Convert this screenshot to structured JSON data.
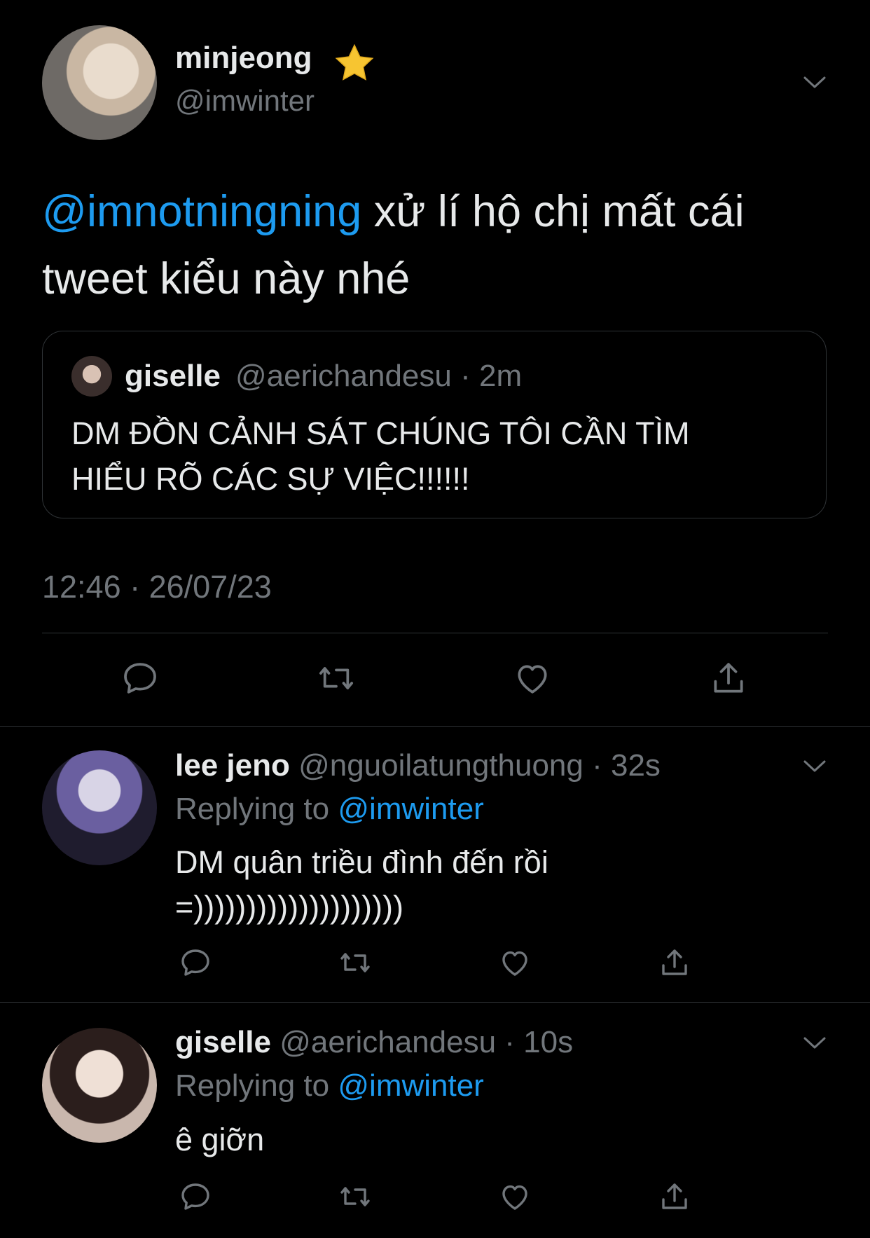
{
  "main_tweet": {
    "author_name": "minjeong",
    "author_handle": "@imwinter",
    "mention": "@imnotningning",
    "text": " xử lí hộ chị mất cái tweet kiểu này nhé",
    "timestamp": "12:46 · 26/07/23",
    "quoted": {
      "author_name": "giselle",
      "author_handle": "@aerichandesu",
      "time": "2m",
      "text": "DM ĐỒN CẢNH SÁT CHÚNG TÔI CẦN TÌM HIỂU RÕ CÁC SỰ VIỆC!!!!!!"
    }
  },
  "replies": [
    {
      "author_name": "lee jeno",
      "author_handle": "@nguoilatungthuong",
      "time": "32s",
      "replying_label": "Replying to",
      "replying_to": "@imwinter",
      "text": "DM quân triều đình đến rồi =))))))))))))))))))))"
    },
    {
      "author_name": "giselle",
      "author_handle": "@aerichandesu",
      "time": "10s",
      "replying_label": "Replying to",
      "replying_to": "@imwinter",
      "text": "ê giỡn"
    }
  ],
  "colors": {
    "background": "#000000",
    "text": "#e7e9ea",
    "muted": "#71767b",
    "link": "#1d9bf0",
    "divider": "#2f3336"
  },
  "icons": [
    "reply-icon",
    "retweet-icon",
    "like-icon",
    "share-icon",
    "chevron-down-icon",
    "star-emoji-icon"
  ]
}
